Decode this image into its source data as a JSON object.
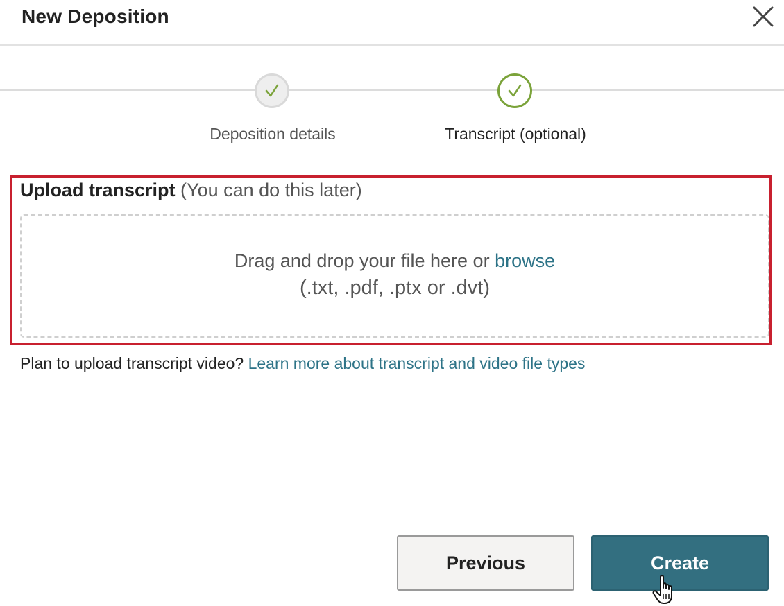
{
  "dialog": {
    "title": "New Deposition",
    "close_icon": "close-icon"
  },
  "stepper": {
    "steps": [
      {
        "label": "Deposition details",
        "status": "completed",
        "icon": "check-icon",
        "check_color": "#7ba33a"
      },
      {
        "label": "Transcript (optional)",
        "status": "current",
        "icon": "check-icon",
        "check_color": "#7ba33a"
      }
    ]
  },
  "upload": {
    "heading": "Upload transcript",
    "heading_note": "(You can do this later)",
    "drop_text": "Drag and drop your file here or",
    "browse_label": "browse",
    "file_types": "(.txt, .pdf, .ptx or .dvt)"
  },
  "hint": {
    "text": "Plan to upload transcript video?",
    "link_label": "Learn more about transcript and video file types"
  },
  "footer": {
    "previous_label": "Previous",
    "create_label": "Create"
  },
  "colors": {
    "primary": "#336f80",
    "link": "#2d7387",
    "success": "#7ba33a",
    "highlight": "#c8202f"
  },
  "cursor_icon": "hand-pointer-icon"
}
